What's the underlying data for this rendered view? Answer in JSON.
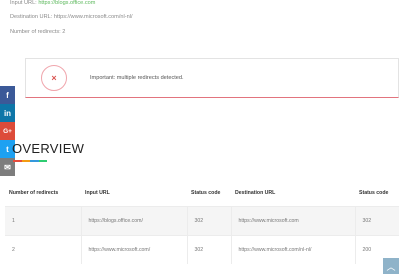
{
  "summary": {
    "input_label": "Input URL:",
    "input_url": "https://blogs.office.com",
    "destination_label": "Destination URL:",
    "destination_url": "https://www.microsoft.com/nl-nl/",
    "redirects_label": "Number of redirects:",
    "redirects_count": "2"
  },
  "alert": {
    "icon": "close-icon",
    "symbol": "×",
    "message": "Important: multiple redirects detected."
  },
  "share": [
    {
      "name": "facebook",
      "glyph": "f"
    },
    {
      "name": "linkedin",
      "glyph": "in"
    },
    {
      "name": "google-plus",
      "glyph": "G+"
    },
    {
      "name": "twitter",
      "glyph": "t"
    },
    {
      "name": "email",
      "glyph": "✉"
    }
  ],
  "overview": {
    "title": "OVERVIEW",
    "underline_colors": [
      "#e74c3c",
      "#f39c12",
      "#3498db",
      "#2ecc71"
    ]
  },
  "table": {
    "headers": [
      "Number of redirects",
      "Input URL",
      "Status code",
      "Destination URL",
      "Status code"
    ],
    "rows": [
      [
        "1",
        "https://blogs.office.com/",
        "302",
        "https://www.microsoft.com",
        "302"
      ],
      [
        "2",
        "https://www.microsoft.com/",
        "302",
        "https://www.microsoft.com/nl-nl/",
        "200"
      ]
    ]
  },
  "scroll_top": {
    "glyph": "︿"
  }
}
